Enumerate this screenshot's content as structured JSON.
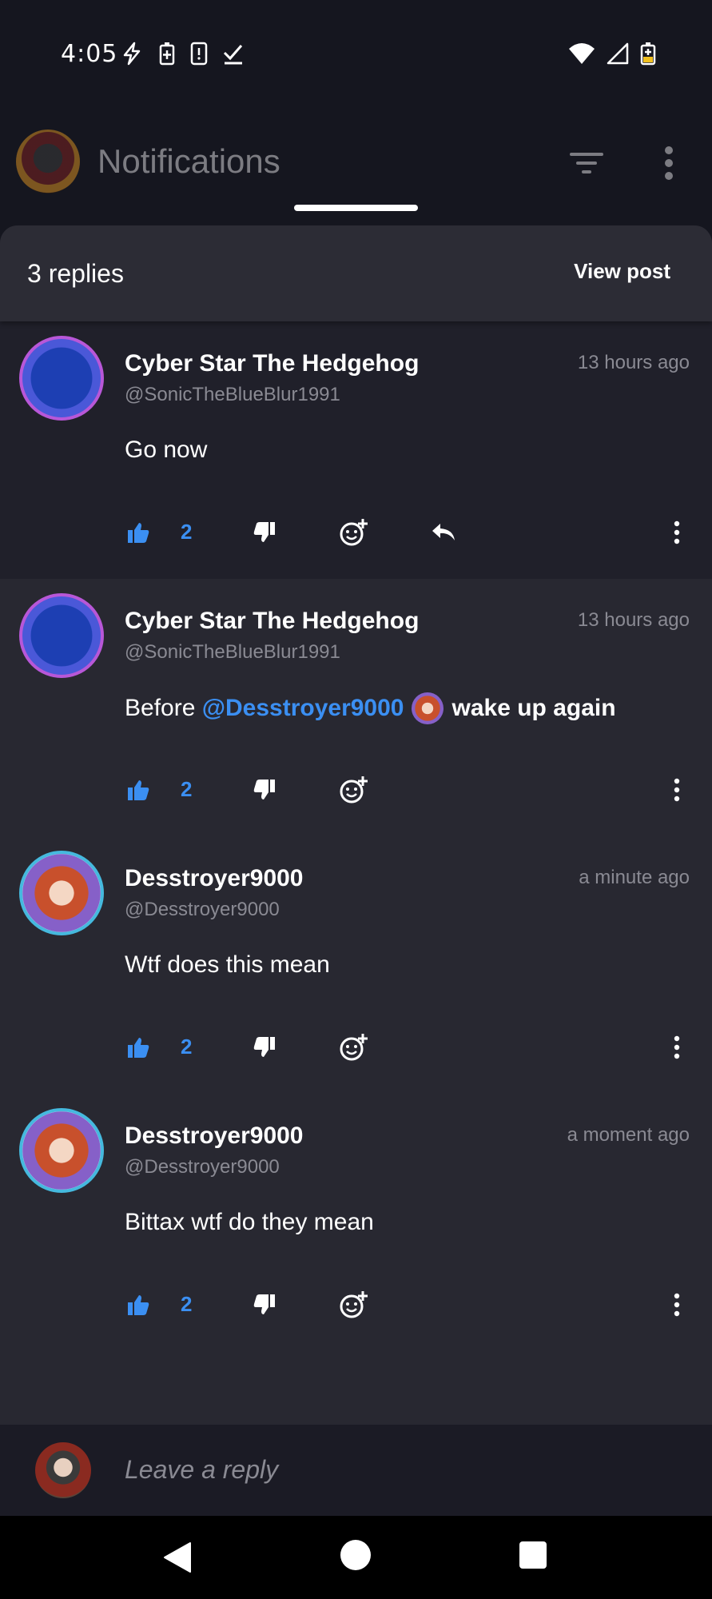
{
  "status_bar": {
    "time": "4:05",
    "left_icons": [
      "flash-icon",
      "battery-saver-icon",
      "device-alert-icon",
      "check-icon"
    ],
    "right_icons": [
      "wifi-icon",
      "signal-icon",
      "battery-charging-icon"
    ]
  },
  "header": {
    "title": "Notifications"
  },
  "sheet": {
    "replies_count": "3 replies",
    "view_post": "View post"
  },
  "comments": [
    {
      "name": "Cyber Star The Hedgehog",
      "handle": "@SonicTheBlueBlur1991",
      "time": "13 hours ago",
      "body": "Go now",
      "likes": "2"
    },
    {
      "name": "Cyber Star The Hedgehog",
      "handle": "@SonicTheBlueBlur1991",
      "time": "13 hours ago",
      "body_prefix": "Before ",
      "mention": "@Desstroyer9000",
      "body_suffix": "wake up again",
      "likes": "2"
    },
    {
      "name": "Desstroyer9000",
      "handle": "@Desstroyer9000",
      "time": "a minute ago",
      "body": "Wtf does this mean",
      "likes": "2"
    },
    {
      "name": "Desstroyer9000",
      "handle": "@Desstroyer9000",
      "time": "a moment ago",
      "body": "Bittax wtf do they mean",
      "likes": "2"
    }
  ],
  "reply_bar": {
    "placeholder": "Leave a reply"
  },
  "colors": {
    "accent": "#3b8ff2",
    "background": "#15161f",
    "sheet": "#282831"
  }
}
